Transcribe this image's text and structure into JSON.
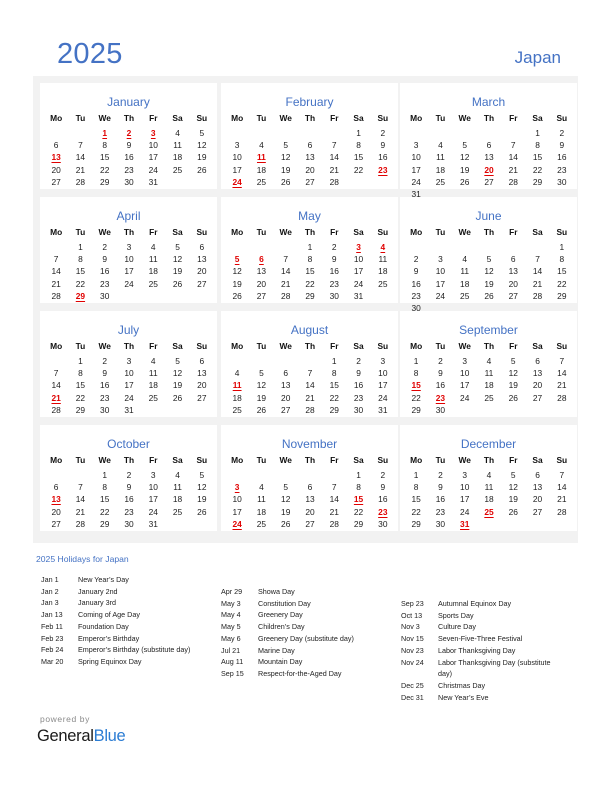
{
  "header": {
    "year": "2025",
    "country": "Japan"
  },
  "weekdays": [
    "Mo",
    "Tu",
    "We",
    "Th",
    "Fr",
    "Sa",
    "Su"
  ],
  "months": [
    {
      "name": "January",
      "offset": 2,
      "days": 31,
      "holidays": [
        1,
        2,
        3,
        13
      ]
    },
    {
      "name": "February",
      "offset": 5,
      "days": 28,
      "holidays": [
        11,
        23,
        24
      ]
    },
    {
      "name": "March",
      "offset": 5,
      "days": 31,
      "holidays": [
        20
      ]
    },
    {
      "name": "April",
      "offset": 1,
      "days": 30,
      "holidays": [
        29
      ]
    },
    {
      "name": "May",
      "offset": 3,
      "days": 31,
      "holidays": [
        3,
        4,
        5,
        6
      ]
    },
    {
      "name": "June",
      "offset": 6,
      "days": 30,
      "holidays": []
    },
    {
      "name": "July",
      "offset": 1,
      "days": 31,
      "holidays": [
        21
      ]
    },
    {
      "name": "August",
      "offset": 4,
      "days": 31,
      "holidays": [
        11
      ]
    },
    {
      "name": "September",
      "offset": 0,
      "days": 30,
      "holidays": [
        15,
        23
      ]
    },
    {
      "name": "October",
      "offset": 2,
      "days": 31,
      "holidays": [
        13
      ]
    },
    {
      "name": "November",
      "offset": 5,
      "days": 30,
      "holidays": [
        3,
        15,
        23,
        24
      ]
    },
    {
      "name": "December",
      "offset": 0,
      "days": 31,
      "holidays": [
        25,
        31
      ]
    }
  ],
  "holidays_section": {
    "title": "2025 Holidays for Japan",
    "columns": [
      [
        {
          "date": "Jan 1",
          "name": "New Year’s Day"
        },
        {
          "date": "Jan 2",
          "name": "January 2nd"
        },
        {
          "date": "Jan 3",
          "name": "January 3rd"
        },
        {
          "date": "Jan 13",
          "name": "Coming of Age Day"
        },
        {
          "date": "Feb 11",
          "name": "Foundation Day"
        },
        {
          "date": "Feb 23",
          "name": "Emperor’s Birthday"
        },
        {
          "date": "Feb 24",
          "name": "Emperor’s Birthday (substitute day)"
        },
        {
          "date": "Mar 20",
          "name": "Spring Equinox Day"
        }
      ],
      [
        {
          "date": "Apr 29",
          "name": "Showa Day"
        },
        {
          "date": "May 3",
          "name": "Constitution Day"
        },
        {
          "date": "May 4",
          "name": "Greenery Day"
        },
        {
          "date": "May 5",
          "name": "Children’s Day"
        },
        {
          "date": "May 6",
          "name": "Greenery Day (substitute day)"
        },
        {
          "date": "Jul 21",
          "name": "Marine Day"
        },
        {
          "date": "Aug 11",
          "name": "Mountain Day"
        },
        {
          "date": "Sep 15",
          "name": "Respect-for-the-Aged Day"
        }
      ],
      [
        {
          "date": "Sep 23",
          "name": "Autumnal Equinox Day"
        },
        {
          "date": "Oct 13",
          "name": "Sports Day"
        },
        {
          "date": "Nov 3",
          "name": "Culture Day"
        },
        {
          "date": "Nov 15",
          "name": "Seven-Five-Three Festival"
        },
        {
          "date": "Nov 23",
          "name": "Labor Thanksgiving Day"
        },
        {
          "date": "Nov 24",
          "name": "Labor Thanksgiving Day (substitute day)"
        },
        {
          "date": "Dec 25",
          "name": "Christmas Day"
        },
        {
          "date": "Dec 31",
          "name": "New Year’s Eve"
        }
      ]
    ]
  },
  "footer": {
    "powered_by": "powered by",
    "brand_first": "General",
    "brand_second": "Blue"
  },
  "colors": {
    "accent": "#4472c4",
    "holiday": "#e00000",
    "panel": "#f2f2f2",
    "brand_blue": "#2b7cd3"
  }
}
